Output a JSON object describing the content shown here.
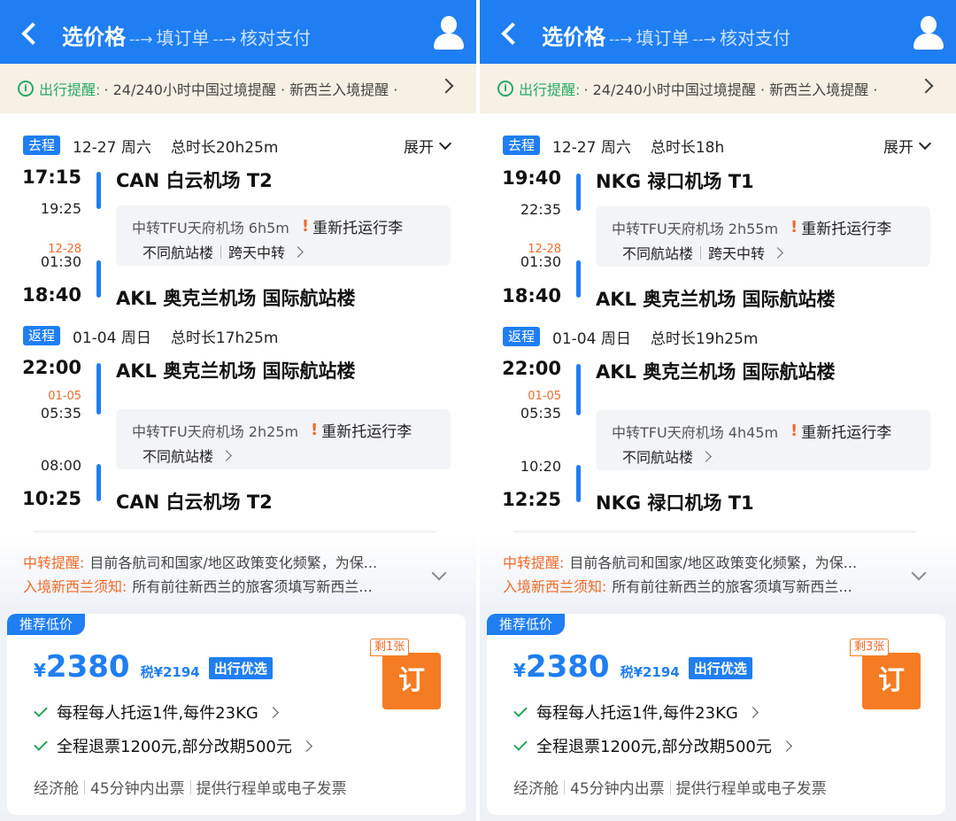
{
  "panels": [
    {
      "header": {
        "title": "选价格",
        "arrow1": "--→",
        "step2": "填订单",
        "arrow2": "--→",
        "step3": "核对支付"
      },
      "reminder": {
        "title": "出行提醒:",
        "text": "· 24/240小时中国过境提醒 · 新西兰入境提醒 ·"
      },
      "outbound": {
        "tag": "去程",
        "date": "12-27 周六",
        "duration": "总时长20h25m",
        "expand": "展开",
        "dep_time": "17:15",
        "dep_airport": "CAN 白云机场 T2",
        "leg1_arr": "19:25",
        "next_day": "12-28",
        "leg2_dep": "01:30",
        "arr_time": "18:40",
        "arr_airport": "AKL 奥克兰机场 国际航站楼",
        "transfer": {
          "text": "中转TFU天府机场 6h5m",
          "warn": "!",
          "recheck": "重新托运行李",
          "tags": [
            "不同航站楼",
            "跨天中转"
          ]
        }
      },
      "return": {
        "tag": "返程",
        "date": "01-04 周日",
        "duration": "总时长17h25m",
        "dep_time": "22:00",
        "dep_airport": "AKL 奥克兰机场 国际航站楼",
        "next_day": "01-05",
        "leg1_arr": "05:35",
        "leg2_dep": "08:00",
        "arr_time": "10:25",
        "arr_airport": "CAN 白云机场 T2",
        "transfer": {
          "text": "中转TFU天府机场 2h25m",
          "warn": "!",
          "recheck": "重新托运行李",
          "tags": [
            "不同航站楼"
          ]
        }
      },
      "notices": [
        {
          "title": "中转提醒:",
          "body": "目前各航司和国家/地区政策变化频繁，为保..."
        },
        {
          "title": "入境新西兰须知:",
          "body": "所有前往新西兰的旅客须填写新西兰..."
        }
      ],
      "offer": {
        "tag": "推荐低价",
        "yen": "¥",
        "price": "2380",
        "tax": "税¥2194",
        "badge": "出行优选",
        "remaining": "剩1张",
        "book": "订",
        "checks": [
          "每程每人托运1件,每件23KG",
          "全程退票1200元,部分改期500元"
        ],
        "footer": [
          "经济舱",
          "45分钟内出票",
          "提供行程单或电子发票"
        ]
      }
    },
    {
      "header": {
        "title": "选价格",
        "arrow1": "--→",
        "step2": "填订单",
        "arrow2": "--→",
        "step3": "核对支付"
      },
      "reminder": {
        "title": "出行提醒:",
        "text": "· 24/240小时中国过境提醒 · 新西兰入境提醒 ·"
      },
      "outbound": {
        "tag": "去程",
        "date": "12-27 周六",
        "duration": "总时长18h",
        "expand": "展开",
        "dep_time": "19:40",
        "dep_airport": "NKG 禄口机场 T1",
        "leg1_arr": "22:35",
        "next_day": "12-28",
        "leg2_dep": "01:30",
        "arr_time": "18:40",
        "arr_airport": "AKL 奥克兰机场 国际航站楼",
        "transfer": {
          "text": "中转TFU天府机场 2h55m",
          "warn": "!",
          "recheck": "重新托运行李",
          "tags": [
            "不同航站楼",
            "跨天中转"
          ]
        }
      },
      "return": {
        "tag": "返程",
        "date": "01-04 周日",
        "duration": "总时长19h25m",
        "dep_time": "22:00",
        "dep_airport": "AKL 奥克兰机场 国际航站楼",
        "next_day": "01-05",
        "leg1_arr": "05:35",
        "leg2_dep": "10:20",
        "arr_time": "12:25",
        "arr_airport": "NKG 禄口机场 T1",
        "transfer": {
          "text": "中转TFU天府机场 4h45m",
          "warn": "!",
          "recheck": "重新托运行李",
          "tags": [
            "不同航站楼"
          ]
        }
      },
      "notices": [
        {
          "title": "中转提醒:",
          "body": "目前各航司和国家/地区政策变化频繁，为保..."
        },
        {
          "title": "入境新西兰须知:",
          "body": "所有前往新西兰的旅客须填写新西兰..."
        }
      ],
      "offer": {
        "tag": "推荐低价",
        "yen": "¥",
        "price": "2380",
        "tax": "税¥2194",
        "badge": "出行优选",
        "remaining": "剩3张",
        "book": "订",
        "checks": [
          "每程每人托运1件,每件23KG",
          "全程退票1200元,部分改期500元"
        ],
        "footer": [
          "经济舱",
          "45分钟内出票",
          "提供行程单或电子发票"
        ]
      }
    }
  ]
}
